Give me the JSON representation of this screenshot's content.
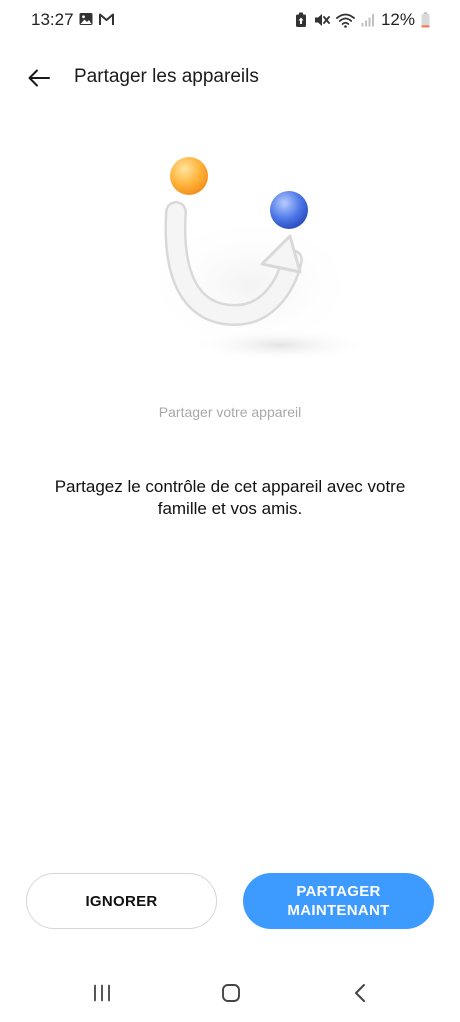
{
  "status_bar": {
    "time": "13:27",
    "left_icons": [
      "gallery-icon",
      "gmail-icon"
    ],
    "right_icons": [
      "battery-saver-icon",
      "mute-icon",
      "wifi-icon",
      "signal-icon",
      "battery-icon"
    ],
    "battery_text": "12%",
    "battery_color": "#f4795b"
  },
  "app_bar": {
    "title": "Partager les appareils",
    "back_icon": "arrow-left-icon"
  },
  "illustration": {
    "caption": "Partager votre appareil",
    "orange_ball_color": "#ffb43a",
    "blue_ball_color": "#3e67d8"
  },
  "description": "Partagez le contrôle de cet appareil avec votre famille et vos amis.",
  "buttons": {
    "ignore_label": "IGNORER",
    "share_label": "PARTAGER MAINTENANT",
    "accent_color": "#3d9bff"
  },
  "nav_bar": {
    "icons": [
      "recent-apps-icon",
      "home-icon",
      "back-icon"
    ]
  }
}
